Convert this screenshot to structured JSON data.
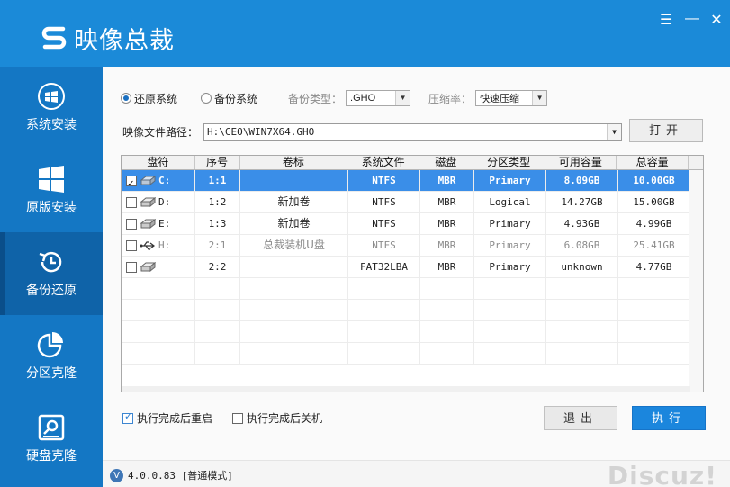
{
  "app": {
    "title": "映像总裁",
    "brand_color": "#1b8ad8"
  },
  "window_controls": {
    "menu_icon": "menu-icon",
    "minimize": "—",
    "close": "✕",
    "menu": "☰"
  },
  "sidebar": {
    "items": [
      {
        "label": "系统安装",
        "icon": "windows-logo-icon",
        "active": false
      },
      {
        "label": "原版安装",
        "icon": "windows-tiles-icon",
        "active": false
      },
      {
        "label": "备份还原",
        "icon": "backup-restore-icon",
        "active": true
      },
      {
        "label": "分区克隆",
        "icon": "pie-chart-icon",
        "active": false
      },
      {
        "label": "硬盘克隆",
        "icon": "disk-search-icon",
        "active": false
      }
    ]
  },
  "mode": {
    "restore_label": "还原系统",
    "backup_label": "备份系统",
    "selected": "restore",
    "backup_type_label": "备份类型：",
    "backup_type_value": ".GHO",
    "compression_label": "压缩率：",
    "compression_value": "快速压缩"
  },
  "image_path": {
    "label": "映像文件路径：",
    "value": "H:\\CEO\\WIN7X64.GHO",
    "open_button": "打开"
  },
  "table": {
    "headers": [
      "盘符",
      "序号",
      "卷标",
      "系统文件",
      "磁盘",
      "分区类型",
      "可用容量",
      "总容量"
    ],
    "rows": [
      {
        "checked": true,
        "drive": "C:",
        "index": "1:1",
        "label": "",
        "fs": "NTFS",
        "disk": "MBR",
        "type": "Primary",
        "free": "8.09GB",
        "total": "10.00GB",
        "selected": true,
        "dim": false,
        "icon": "hard-disk-icon"
      },
      {
        "checked": false,
        "drive": "D:",
        "index": "1:2",
        "label": "新加卷",
        "fs": "NTFS",
        "disk": "MBR",
        "type": "Logical",
        "free": "14.27GB",
        "total": "15.00GB",
        "selected": false,
        "dim": false,
        "icon": "hard-disk-icon"
      },
      {
        "checked": false,
        "drive": "E:",
        "index": "1:3",
        "label": "新加卷",
        "fs": "NTFS",
        "disk": "MBR",
        "type": "Primary",
        "free": "4.93GB",
        "total": "4.99GB",
        "selected": false,
        "dim": false,
        "icon": "hard-disk-icon"
      },
      {
        "checked": false,
        "drive": "H:",
        "index": "2:1",
        "label": "总裁装机U盘",
        "fs": "NTFS",
        "disk": "MBR",
        "type": "Primary",
        "free": "6.08GB",
        "total": "25.41GB",
        "selected": false,
        "dim": true,
        "icon": "usb-icon"
      },
      {
        "checked": false,
        "drive": "",
        "index": "2:2",
        "label": "",
        "fs": "FAT32LBA",
        "disk": "MBR",
        "type": "Primary",
        "free": "unknown",
        "total": "4.77GB",
        "selected": false,
        "dim": false,
        "icon": "hard-disk-icon"
      }
    ],
    "empty_rows": 5
  },
  "options": {
    "restart_label": "执行完成后重启",
    "restart_checked": true,
    "shutdown_label": "执行完成后关机",
    "shutdown_checked": false
  },
  "actions": {
    "exit": "退出",
    "execute": "执行"
  },
  "status": {
    "version_badge": "V",
    "version_text": "4.0.0.83 [普通模式]"
  },
  "watermark": "Discuz!"
}
